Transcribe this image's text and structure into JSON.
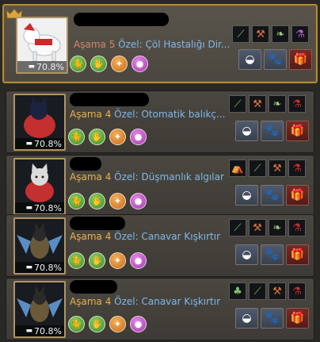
{
  "pets": [
    {
      "stage_label": "Aşama",
      "stage_value": "5",
      "special": "Özel: Çöl Hastalığı Dir...",
      "percent": "70.8%",
      "selected": true,
      "skill_icons": [
        "cat-skill-icon",
        "hand-skill-icon",
        "compass-skill-icon",
        "potion-skill-icon"
      ],
      "ability_tiles": [
        "fishing-rod-icon",
        "axe-icon",
        "wing-icon",
        "potion-tile-icon"
      ],
      "buttons": [
        "feed-button",
        "care-button",
        "gift-button"
      ]
    },
    {
      "stage_label": "Aşama",
      "stage_value": "4",
      "special": "Özel: Otomatik balıkç...",
      "percent": "70.8%",
      "selected": false,
      "skill_icons": [
        "cat-skill-icon",
        "hand-skill-icon",
        "compass-skill-icon",
        "potion-skill-icon"
      ],
      "ability_tiles": [
        "fishing-rod-icon",
        "axe-icon",
        "wing-icon",
        "potion-tile-icon"
      ],
      "buttons": [
        "feed-button",
        "care-button",
        "gift-button"
      ]
    },
    {
      "stage_label": "Aşama",
      "stage_value": "4",
      "special": "Özel: Düşmanlık algılar",
      "percent": "70.8%",
      "selected": false,
      "skill_icons": [
        "cat-skill-icon",
        "hand-skill-icon",
        "compass-skill-icon",
        "potion-skill-icon"
      ],
      "ability_tiles": [
        "tent-icon",
        "fishing-rod-icon",
        "axe-icon",
        "potion-tile-icon"
      ],
      "buttons": [
        "feed-button",
        "care-button",
        "gift-button"
      ]
    },
    {
      "stage_label": "Aşama",
      "stage_value": "4",
      "special": "Özel: Canavar Kışkırtır",
      "percent": "70.8%",
      "selected": false,
      "skill_icons": [
        "cat-skill-icon",
        "hand-skill-icon",
        "compass-skill-icon",
        "potion-skill-icon"
      ],
      "ability_tiles": [
        "fishing-rod-icon",
        "axe-icon",
        "wing-icon",
        "potion-tile-icon"
      ],
      "buttons": [
        "feed-button",
        "care-button",
        "gift-button"
      ]
    },
    {
      "stage_label": "Aşama",
      "stage_value": "4",
      "special": "Özel: Canavar Kışkırtır",
      "percent": "70.8%",
      "selected": false,
      "skill_icons": [
        "cat-skill-icon",
        "hand-skill-icon",
        "compass-skill-icon",
        "potion-skill-icon"
      ],
      "ability_tiles": [
        "clover-icon",
        "fishing-rod-icon",
        "axe-icon",
        "potion-tile-icon"
      ],
      "buttons": [
        "feed-button",
        "care-button",
        "gift-button"
      ]
    }
  ],
  "colors": {
    "stage_gold": "#e8b14a",
    "special_blue": "#7fb8ea",
    "selected_border": "#b08a35"
  }
}
